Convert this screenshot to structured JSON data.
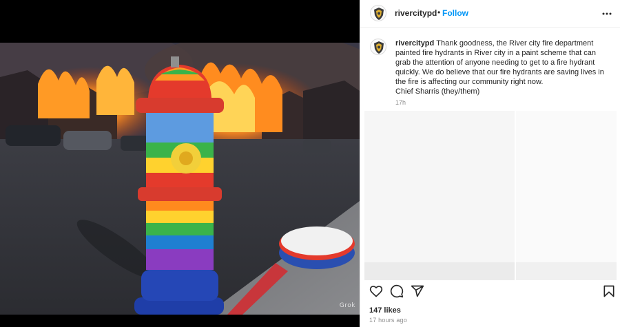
{
  "post": {
    "username": "rivercitypd",
    "separator": "•",
    "follow_label": "Follow",
    "more_icon": "more-options-icon",
    "caption_lines": [
      "Thank goodness, the River city fire department",
      "painted fire hydrants in River city in a paint scheme that can",
      "grab the attention of anyone needing to get to a fire hydrant",
      "quickly. We do believe that our fire hydrants are saving lives in",
      "the fire is affecting our community right now.",
      "Chief Sharris (they/them)"
    ],
    "timestamp": "17h",
    "likes": "147 likes",
    "posted_ago": "17 hours ago"
  },
  "media": {
    "watermark": "Grok"
  },
  "actions": {
    "like_icon": "heart-icon",
    "comment_icon": "comment-icon",
    "share_icon": "share-icon",
    "save_icon": "bookmark-icon"
  },
  "colors": {
    "follow_blue": "#0095f6",
    "text": "#262626",
    "muted": "#8e8e8e",
    "divider": "#efefef"
  }
}
